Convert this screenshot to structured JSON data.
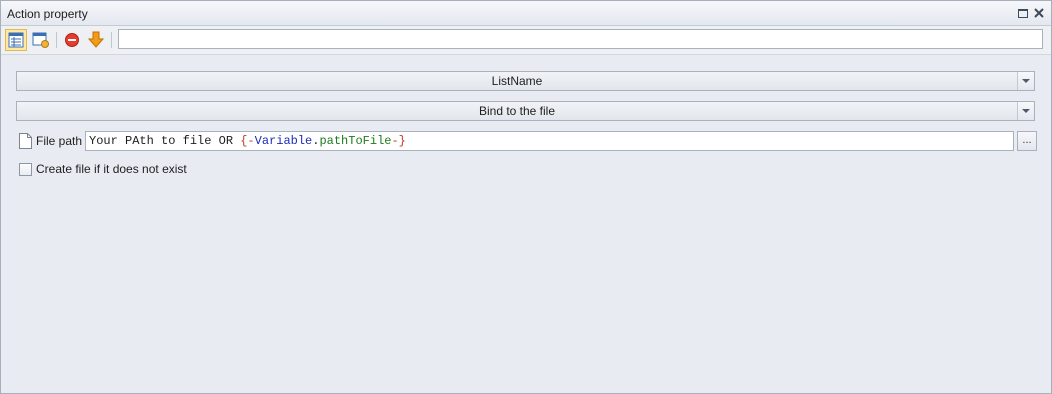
{
  "window": {
    "title": "Action property",
    "restore_icon": "restore-icon",
    "close_icon": "close-icon"
  },
  "toolbar": {
    "buttons": [
      {
        "icon": "property-grid-icon",
        "active": true
      },
      {
        "icon": "property-editor-icon",
        "active": false
      },
      {
        "icon": "stop-icon",
        "active": false
      },
      {
        "icon": "download-arrow-icon",
        "active": false
      }
    ],
    "search_value": ""
  },
  "form": {
    "list_combo": {
      "value": "ListName"
    },
    "bind_combo": {
      "value": "Bind to the file"
    },
    "file_path": {
      "label": "File path",
      "value_prefix": "Your PAth to file OR ",
      "brace_open": "{-",
      "var_keyword": "Variable",
      "dot": ".",
      "var_name": "pathToFile",
      "brace_close": "-}",
      "browse_label": "..."
    },
    "create_file": {
      "label": "Create file if it does not exist",
      "checked": false
    }
  },
  "colors": {
    "background": "#e8ebf1",
    "brace": "#c0392b",
    "variable": "#1d2bb8",
    "var_name": "#1e7b1e",
    "active_button": "#fde9a6"
  }
}
